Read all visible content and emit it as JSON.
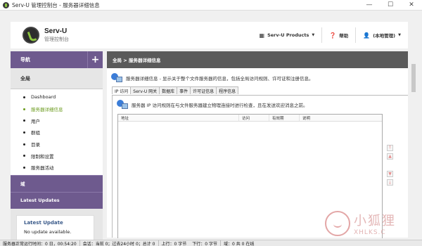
{
  "window": {
    "title": "Serv-U 管理控制台 - 服务器详细信息",
    "controls": [
      "—",
      "☐",
      "✕"
    ]
  },
  "header": {
    "brand_name": "Serv-U",
    "brand_sub": "管理控制台",
    "products_label": "Serv-U Products",
    "help_label": "帮助",
    "user_label": "(本地管理)"
  },
  "sidebar": {
    "nav_label": "导航",
    "plus": "+",
    "global_label": "全局",
    "items": [
      {
        "label": "Dashboard"
      },
      {
        "label": "服务器详细信息",
        "active": true
      },
      {
        "label": "用户"
      },
      {
        "label": "群组"
      },
      {
        "label": "目录"
      },
      {
        "label": "限制和设置"
      },
      {
        "label": "服务器活动"
      }
    ],
    "domain_label": "域",
    "updates_label": "Latest Updates",
    "latest_update_title": "Latest Update",
    "latest_update_value": "No update available."
  },
  "main": {
    "breadcrumb": "全局 > 服务器详细信息",
    "description": "服务器详细信息 - 显示关于整个文件服务器的信息，包括全局访问规则、许可证和注册信息。",
    "tabs": [
      "IP 访问",
      "Serv-U 网关",
      "数据库",
      "事件",
      "许可证信息",
      "程序信息"
    ],
    "panel_description": "服务器 IP 访问规则在与文件服务器建立物理连接时进行检查，且在发送欢迎消息之前。",
    "columns": [
      "地址",
      "访问",
      "有效期",
      "说明"
    ]
  },
  "statusbar": {
    "uptime": "服务器正常运行时间：0 日，00:54:20",
    "sessions": "会话：当前 0；过去24小时 0；总计 0",
    "upload": "上行：0 字节",
    "download": "下行：0 字节",
    "domains": "域：0 共 0 在线"
  },
  "watermark": {
    "big": "小狐狸",
    "small": "XHLKS.C"
  },
  "colors": {
    "purple": "#6e5a8e",
    "breadcrumb": "#5a5a5a",
    "active_green": "#6b9b1e",
    "update_blue": "#3b5b8a"
  }
}
